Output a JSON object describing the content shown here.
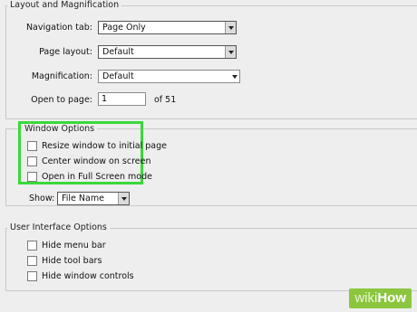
{
  "layout_group": {
    "title": "Layout and Magnification",
    "navigation_tab": {
      "label": "Navigation tab:",
      "value": "Page Only"
    },
    "page_layout": {
      "label": "Page layout:",
      "value": "Default"
    },
    "magnification": {
      "label": "Magnification:",
      "value": "Default"
    },
    "open_to_page": {
      "label": "Open to page:",
      "value": "1",
      "suffix": "of 51"
    }
  },
  "window_options": {
    "title": "Window Options",
    "items": [
      {
        "label": "Resize window to initial page",
        "checked": false
      },
      {
        "label": "Center window on screen",
        "checked": false
      },
      {
        "label": "Open in Full Screen mode",
        "checked": false
      }
    ],
    "highlight_color": "#3bd83b"
  },
  "show": {
    "label": "Show:",
    "value": "File Name"
  },
  "ui_options": {
    "title": "User Interface Options",
    "items": [
      {
        "label": "Hide menu bar",
        "checked": false
      },
      {
        "label": "Hide tool bars",
        "checked": false
      },
      {
        "label": "Hide window controls",
        "checked": false
      }
    ]
  },
  "watermark": {
    "prefix": "wiki",
    "suffix": "How",
    "color": "#8cc63f"
  }
}
